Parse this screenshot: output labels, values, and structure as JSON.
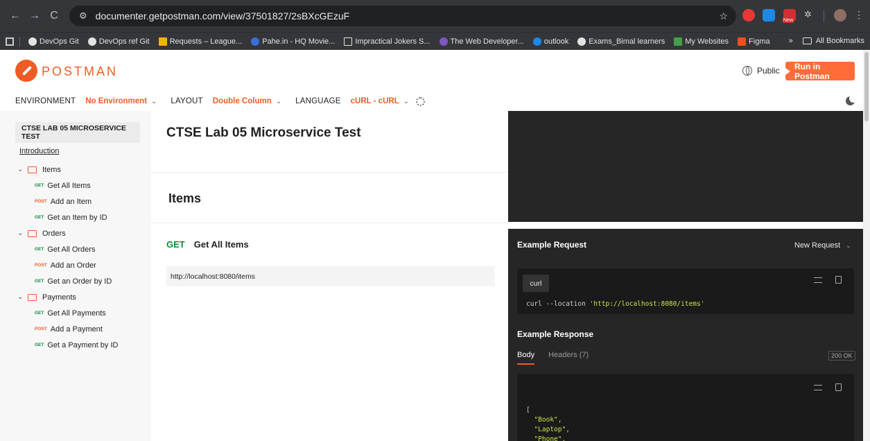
{
  "browser": {
    "url": "documenter.getpostman.com/view/37501827/2sBXcGEzuF",
    "nav": {
      "back": "←",
      "forward": "→",
      "reload": "C"
    },
    "ext_new_badge": "New",
    "bookmarks": [
      "DevOps Git",
      "DevOps ref Git",
      "Requests – League...",
      "Pahe.in - HQ Movie...",
      "Impractical Jokers S...",
      "The Web Developer...",
      "outlook",
      "Exams_Bimal learners",
      "My Websites",
      "Figma"
    ],
    "overflow": "»",
    "all_bookmarks": "All Bookmarks"
  },
  "header": {
    "brand": "POSTMAN",
    "public_label": "Public",
    "run_button": "Run in Postman"
  },
  "settings": {
    "environment_label": "ENVIRONMENT",
    "environment_value": "No Environment",
    "layout_label": "LAYOUT",
    "layout_value": "Double Column",
    "language_label": "LANGUAGE",
    "language_value": "cURL - cURL"
  },
  "sidebar": {
    "collection_title": "CTSE LAB 05 MICROSERVICE TEST",
    "intro": "Introduction",
    "folders": [
      {
        "name": "Items",
        "requests": [
          {
            "method": "GET",
            "name": "Get All Items"
          },
          {
            "method": "POST",
            "name": "Add an Item"
          },
          {
            "method": "GET",
            "name": "Get an Item by ID"
          }
        ]
      },
      {
        "name": "Orders",
        "requests": [
          {
            "method": "GET",
            "name": "Get All Orders"
          },
          {
            "method": "POST",
            "name": "Add an Order"
          },
          {
            "method": "GET",
            "name": "Get an Order by ID"
          }
        ]
      },
      {
        "name": "Payments",
        "requests": [
          {
            "method": "GET",
            "name": "Get All Payments"
          },
          {
            "method": "POST",
            "name": "Add a Payment"
          },
          {
            "method": "GET",
            "name": "Get a Payment by ID"
          }
        ]
      }
    ]
  },
  "main": {
    "title": "CTSE Lab 05 Microservice Test",
    "section": "Items",
    "request_method": "GET",
    "request_name": "Get All Items",
    "request_url": "http://localhost:8080/items"
  },
  "right": {
    "example_request": "Example Request",
    "new_request": "New Request",
    "code_tab": "curl",
    "curl_cmd": "curl --location",
    "curl_url": "'http://localhost:8080/items'",
    "example_response": "Example Response",
    "tab_body": "Body",
    "tab_headers": "Headers (7)",
    "status": "200 OK",
    "json_open": "[",
    "json_items": [
      "\"Book\",",
      "\"Laptop\",",
      "\"Phone\","
    ]
  },
  "colors": {
    "accent": "#ef5b25",
    "get": "#0f8c3c",
    "dark_panel": "#262626"
  }
}
